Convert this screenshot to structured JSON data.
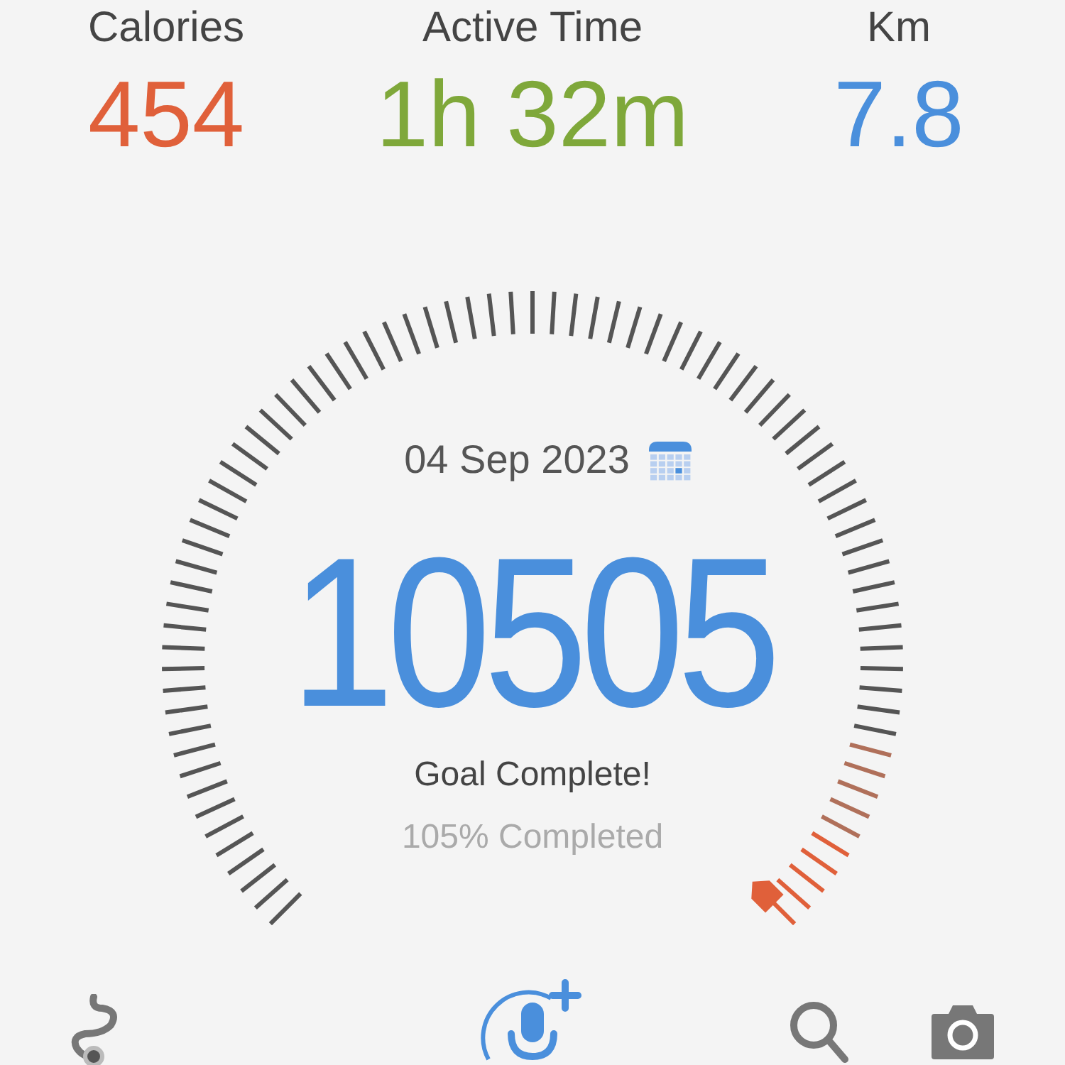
{
  "stats": [
    {
      "label": "Calories",
      "value": "454",
      "color": "#e0603a"
    },
    {
      "label": "Active Time",
      "value": "1h 32m",
      "color": "#7fa83a"
    },
    {
      "label": "Km",
      "value": "7.8",
      "color": "#4a8fdc"
    }
  ],
  "gauge": {
    "date": "04 Sep 2023",
    "steps": "10505",
    "status": "Goal Complete!",
    "percent": "105% Completed"
  },
  "nav": [
    {
      "kind": "route"
    },
    {
      "kind": "voice"
    },
    {
      "kind": "search"
    },
    {
      "kind": "camera"
    }
  ]
}
